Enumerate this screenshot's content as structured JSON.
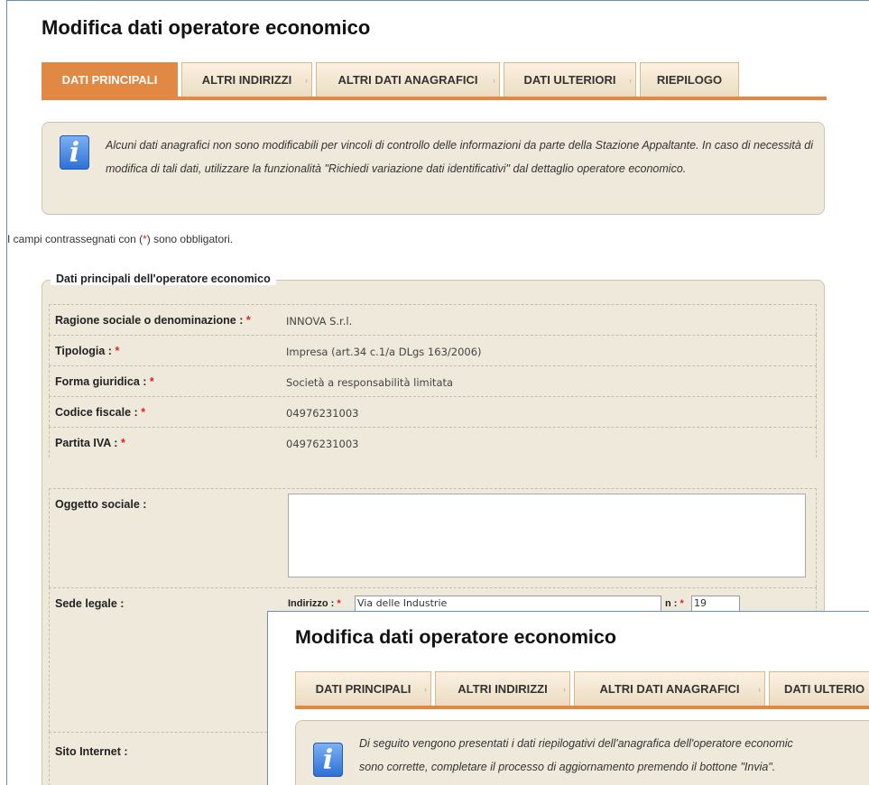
{
  "page_title": "Modifica dati operatore economico",
  "tabs": [
    {
      "label": "DATI PRINCIPALI"
    },
    {
      "label": "ALTRI INDIRIZZI"
    },
    {
      "label": "ALTRI DATI ANAGRAFICI"
    },
    {
      "label": "DATI ULTERIORI"
    },
    {
      "label": "RIEPILOGO"
    }
  ],
  "info_message": "Alcuni dati anagrafici non sono modificabili per vincoli di controllo delle informazioni da parte della Stazione Appaltante. In caso di necessità di modifica di tali dati, utilizzare la funzionalità \"Richiedi variazione dati identificativi\" dal dettaglio operatore economico.",
  "mandatory_note": {
    "before": "I campi contrassegnati con (",
    "star": "*",
    "after": ") sono obbligatori."
  },
  "section_title": "Dati principali dell'operatore economico",
  "fields": {
    "ragione_sociale": {
      "label": "Ragione sociale o denominazione :",
      "value": "INNOVA S.r.l."
    },
    "tipologia": {
      "label": "Tipologia :",
      "value": "Impresa (art.34 c.1/a DLgs 163/2006)"
    },
    "forma_giuridica": {
      "label": "Forma giuridica :",
      "value": "Società a responsabilità limitata"
    },
    "codice_fiscale": {
      "label": "Codice fiscale :",
      "value": "04976231003"
    },
    "partita_iva": {
      "label": "Partita IVA :",
      "value": "04976231003"
    },
    "oggetto_sociale": {
      "label": "Oggetto sociale :",
      "value": ""
    },
    "sede_legale": {
      "label": "Sede legale :",
      "indirizzo_label": "Indirizzo :",
      "indirizzo_value": "Via delle Industrie",
      "numero_label": "n :",
      "numero_value": "19"
    },
    "sito_internet": {
      "label": "Sito Internet :"
    }
  },
  "required_marker": "*",
  "overlay": {
    "page_title": "Modifica dati operatore economico",
    "tabs": [
      {
        "label": "DATI PRINCIPALI"
      },
      {
        "label": "ALTRI INDIRIZZI"
      },
      {
        "label": "ALTRI DATI ANAGRAFICI"
      },
      {
        "label": "DATI ULTERIO"
      }
    ],
    "info_message_line1": "Di seguito vengono presentati i dati riepilogativi dell'anagrafica dell'operatore economic",
    "info_message_line2": "sono corrette, completare il processo di aggiornamento premendo il bottone \"Invia\"."
  },
  "colors": {
    "accent": "#e08844",
    "panel": "#efe9dc",
    "required": "#dd2222"
  },
  "icons": {
    "info": "info-icon"
  }
}
